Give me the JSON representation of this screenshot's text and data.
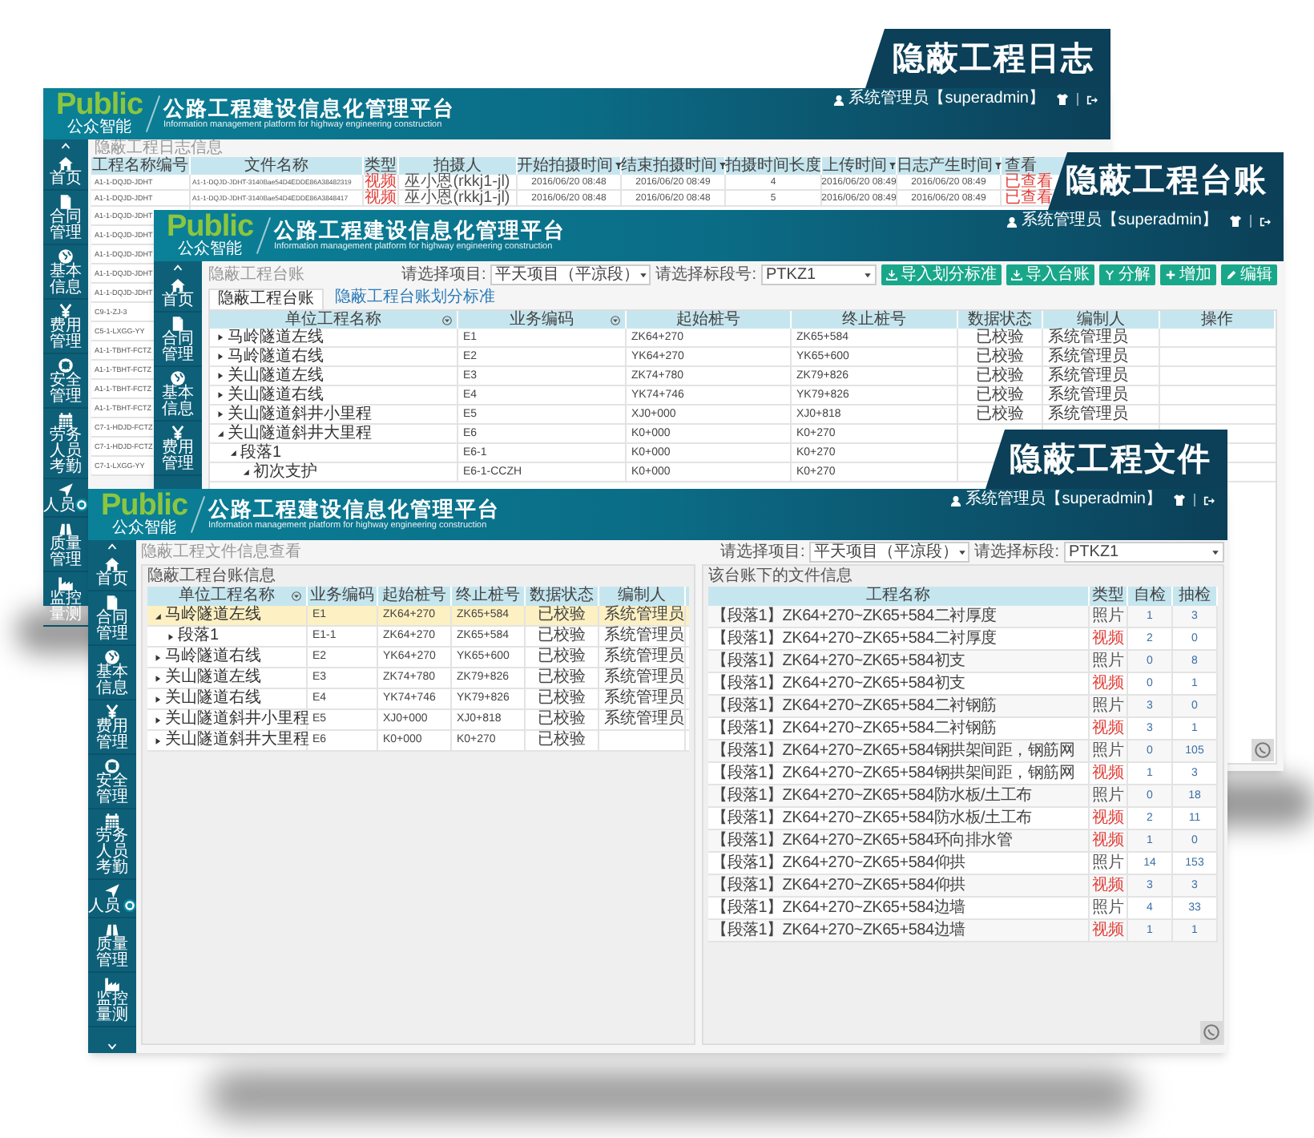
{
  "log_window": {
    "tag": "隐蔽工程日志",
    "header": {
      "logo": "Public",
      "logo_sub": "公众智能",
      "title": "公路工程建设信息化管理平台",
      "subtitle": "Information management platform for highway engineering construction",
      "user": "系统管理员【superadmin】"
    },
    "sidebar": [
      "首页",
      "合同管理",
      "基本信息",
      "费用管理",
      "安全管理",
      "劳务人员考勤",
      "人员",
      "质量管理",
      "监控量测"
    ],
    "breadcrumb": "隐蔽工程日志信息",
    "columns": [
      {
        "label": "工程名称编号",
        "filter": false
      },
      {
        "label": "文件名称",
        "filter": false
      },
      {
        "label": "类型",
        "filter": false
      },
      {
        "label": "拍摄人",
        "filter": false
      },
      {
        "label": "开始拍摄时间",
        "filter": true
      },
      {
        "label": "结束拍摄时间",
        "filter": true
      },
      {
        "label": "拍摄时间长度",
        "filter": false
      },
      {
        "label": "上传时间",
        "filter": true
      },
      {
        "label": "日志产生时间",
        "filter": true
      },
      {
        "label": "查看",
        "filter": false
      }
    ],
    "rows": [
      {
        "kind": "video",
        "cells": [
          "A1-1-DQJD-JDHT",
          "A1-1-DQJD-JDHT-3140Bae54D4EDDE86A38482319",
          "视频",
          "巫小恩(rkkj1-jl)",
          "2016/06/20 08:48",
          "2016/06/20 08:49",
          "4",
          "2016/06/20 08:49",
          "2016/06/20 08:49",
          "已查看"
        ]
      },
      {
        "kind": "video",
        "cells": [
          "A1-1-DQJD-JDHT",
          "A1-1-DQJD-JDHT-3140Bae54D4EDDE86A3848417",
          "视频",
          "巫小恩(rkkj1-jl)",
          "2016/06/20 08:48",
          "2016/06/20 08:48",
          "5",
          "2016/06/20 08:49",
          "2016/06/20 08:49",
          "已查看"
        ]
      },
      {
        "cells": [
          "A1-1-DQJD-JDHT"
        ]
      },
      {
        "cells": [
          "A1-1-DQJD-JDHT"
        ]
      },
      {
        "cells": [
          "A1-1-DQJD-JDHT"
        ]
      },
      {
        "cells": [
          "A1-1-DQJD-JDHT"
        ]
      },
      {
        "cells": [
          "A1-1-DQJD-JDHT"
        ]
      },
      {
        "cells": [
          "C9-1-ZJ-3"
        ]
      },
      {
        "cells": [
          "C5-1-LXGG-YY"
        ]
      },
      {
        "cells": [
          "A1-1-TBHT-FCTZ"
        ]
      },
      {
        "cells": [
          "A1-1-TBHT-FCTZ"
        ]
      },
      {
        "cells": [
          "A1-1-TBHT-FCTZ"
        ]
      },
      {
        "cells": [
          "A1-1-TBHT-FCTZ"
        ]
      },
      {
        "cells": [
          "C7-1-HDJD-FCTZ"
        ]
      },
      {
        "cells": [
          "C7-1-HDJD-FCTZ"
        ]
      },
      {
        "cells": [
          "C7-1-LXGG-YY"
        ]
      }
    ]
  },
  "ledger_window": {
    "tag": "隐蔽工程台账",
    "header": {
      "logo": "Public",
      "logo_sub": "公众智能",
      "title": "公路工程建设信息化管理平台",
      "subtitle": "Information management platform for highway engineering construction",
      "user": "系统管理员【superadmin】"
    },
    "sidebar": [
      "首页",
      "合同管理",
      "基本信息",
      "费用管理"
    ],
    "breadcrumb": "隐蔽工程台账",
    "filters": [
      {
        "label": "请选择项目:",
        "value": "平天项目（平凉段）"
      },
      {
        "label": "请选择标段号:",
        "value": "PTKZ1"
      }
    ],
    "buttons": [
      "导入划分标准",
      "导入台账",
      "分解",
      "增加",
      "编辑"
    ],
    "tabs": [
      {
        "label": "隐蔽工程台账",
        "selected": true
      },
      {
        "label": "隐蔽工程台账划分标准",
        "selected": false
      }
    ],
    "columns": [
      {
        "label": "单位工程名称",
        "sortable": true
      },
      {
        "label": "业务编码",
        "sortable": true
      },
      {
        "label": "起始桩号",
        "sortable": false
      },
      {
        "label": "终止桩号",
        "sortable": false
      },
      {
        "label": "数据状态",
        "sortable": false
      },
      {
        "label": "编制人",
        "sortable": false
      },
      {
        "label": "操作",
        "sortable": false
      }
    ],
    "tree": [
      {
        "name": "马岭隧道左线",
        "code": "E1",
        "start": "ZK64+270",
        "end": "ZK65+584",
        "status": "已校验",
        "editor": "系统管理员",
        "expanded": false
      },
      {
        "name": "马岭隧道右线",
        "code": "E2",
        "start": "YK64+270",
        "end": "YK65+600",
        "status": "已校验",
        "editor": "系统管理员",
        "expanded": false
      },
      {
        "name": "关山隧道左线",
        "code": "E3",
        "start": "ZK74+780",
        "end": "ZK79+826",
        "status": "已校验",
        "editor": "系统管理员",
        "expanded": false
      },
      {
        "name": "关山隧道右线",
        "code": "E4",
        "start": "YK74+746",
        "end": "YK79+826",
        "status": "已校验",
        "editor": "系统管理员",
        "expanded": false
      },
      {
        "name": "关山隧道斜井小里程",
        "code": "E5",
        "start": "XJ0+000",
        "end": "XJ0+818",
        "status": "已校验",
        "editor": "系统管理员",
        "expanded": false
      },
      {
        "name": "关山隧道斜井大里程",
        "code": "E6",
        "start": "K0+000",
        "end": "K0+270",
        "expanded": true,
        "children": [
          {
            "name": "段落1",
            "code": "E6-1",
            "start": "K0+000",
            "end": "K0+270",
            "expanded": true,
            "children": [
              {
                "name": "初次支护",
                "code": "E6-1-CCZH",
                "start": "K0+000",
                "end": "K0+270",
                "expanded": true
              }
            ]
          }
        ]
      }
    ]
  },
  "file_window": {
    "tag": "隐蔽工程文件",
    "header": {
      "logo": "Public",
      "logo_sub": "公众智能",
      "title": "公路工程建设信息化管理平台",
      "subtitle": "Information management platform for highway engineering construction",
      "user": "系统管理员【superadmin】"
    },
    "sidebar": [
      "首页",
      "合同管理",
      "基本信息",
      "费用管理",
      "安全管理",
      "劳务人员考勤",
      "人员",
      "质量管理",
      "监控量测"
    ],
    "breadcrumb": "隐蔽工程文件信息查看",
    "filters": [
      {
        "label": "请选择项目:",
        "value": "平天项目（平凉段）"
      },
      {
        "label": "请选择标段:",
        "value": "PTKZ1"
      }
    ],
    "left_title": "隐蔽工程台账信息",
    "left_columns": [
      {
        "label": "单位工程名称",
        "sortable": true
      },
      {
        "label": "业务编码",
        "sortable": false
      },
      {
        "label": "起始桩号",
        "sortable": false
      },
      {
        "label": "终止桩号",
        "sortable": false
      },
      {
        "label": "数据状态",
        "sortable": false
      },
      {
        "label": "编制人",
        "sortable": false
      }
    ],
    "tree": [
      {
        "name": "马岭隧道左线",
        "code": "E1",
        "start": "ZK64+270",
        "end": "ZK65+584",
        "status": "已校验",
        "editor": "系统管理员",
        "expanded": true,
        "selected": true,
        "children": [
          {
            "name": "段落1",
            "code": "E1-1",
            "start": "ZK64+270",
            "end": "ZK65+584",
            "status": "已校验",
            "editor": "系统管理员",
            "expanded": false,
            "selected": false
          }
        ]
      },
      {
        "name": "马岭隧道右线",
        "code": "E2",
        "start": "YK64+270",
        "end": "YK65+600",
        "status": "已校验",
        "editor": "系统管理员",
        "expanded": false,
        "selected": false
      },
      {
        "name": "关山隧道左线",
        "code": "E3",
        "start": "ZK74+780",
        "end": "ZK79+826",
        "status": "已校验",
        "editor": "系统管理员",
        "expanded": false,
        "selected": false
      },
      {
        "name": "关山隧道右线",
        "code": "E4",
        "start": "YK74+746",
        "end": "YK79+826",
        "status": "已校验",
        "editor": "系统管理员",
        "expanded": false,
        "selected": false
      },
      {
        "name": "关山隧道斜井小里程",
        "code": "E5",
        "start": "XJ0+000",
        "end": "XJ0+818",
        "status": "已校验",
        "editor": "系统管理员",
        "expanded": false,
        "selected": false
      },
      {
        "name": "关山隧道斜井大里程",
        "code": "E6",
        "start": "K0+000",
        "end": "K0+270",
        "status": "已校验",
        "expanded": false,
        "selected": false
      }
    ],
    "right_title": "该台账下的文件信息",
    "right_columns": [
      "工程名称",
      "类型",
      "自检",
      "抽检"
    ],
    "files": [
      {
        "name": "【段落1】ZK64+270~ZK65+584二衬厚度",
        "kind": "photo",
        "type": "照片",
        "self": "1",
        "spot": "3"
      },
      {
        "name": "【段落1】ZK64+270~ZK65+584二衬厚度",
        "kind": "video",
        "type": "视频",
        "self": "2",
        "spot": "0"
      },
      {
        "name": "【段落1】ZK64+270~ZK65+584初支",
        "kind": "photo",
        "type": "照片",
        "self": "0",
        "spot": "8"
      },
      {
        "name": "【段落1】ZK64+270~ZK65+584初支",
        "kind": "video",
        "type": "视频",
        "self": "0",
        "spot": "1"
      },
      {
        "name": "【段落1】ZK64+270~ZK65+584二衬钢筋",
        "kind": "photo",
        "type": "照片",
        "self": "3",
        "spot": "0"
      },
      {
        "name": "【段落1】ZK64+270~ZK65+584二衬钢筋",
        "kind": "video",
        "type": "视频",
        "self": "3",
        "spot": "1"
      },
      {
        "name": "【段落1】ZK64+270~ZK65+584钢拱架间距，钢筋网",
        "kind": "photo",
        "type": "照片",
        "self": "0",
        "spot": "105"
      },
      {
        "name": "【段落1】ZK64+270~ZK65+584钢拱架间距，钢筋网",
        "kind": "video",
        "type": "视频",
        "self": "1",
        "spot": "3"
      },
      {
        "name": "【段落1】ZK64+270~ZK65+584防水板/土工布",
        "kind": "photo",
        "type": "照片",
        "self": "0",
        "spot": "18"
      },
      {
        "name": "【段落1】ZK64+270~ZK65+584防水板/土工布",
        "kind": "video",
        "type": "视频",
        "self": "2",
        "spot": "11"
      },
      {
        "name": "【段落1】ZK64+270~ZK65+584环向排水管",
        "kind": "video",
        "type": "视频",
        "self": "1",
        "spot": "0"
      },
      {
        "name": "【段落1】ZK64+270~ZK65+584仰拱",
        "kind": "photo",
        "type": "照片",
        "self": "14",
        "spot": "153"
      },
      {
        "name": "【段落1】ZK64+270~ZK65+584仰拱",
        "kind": "video",
        "type": "视频",
        "self": "3",
        "spot": "3"
      },
      {
        "name": "【段落1】ZK64+270~ZK65+584边墙",
        "kind": "photo",
        "type": "照片",
        "self": "4",
        "spot": "33"
      },
      {
        "name": "【段落1】ZK64+270~ZK65+584边墙",
        "kind": "video",
        "type": "视频",
        "self": "1",
        "spot": "1"
      }
    ]
  }
}
